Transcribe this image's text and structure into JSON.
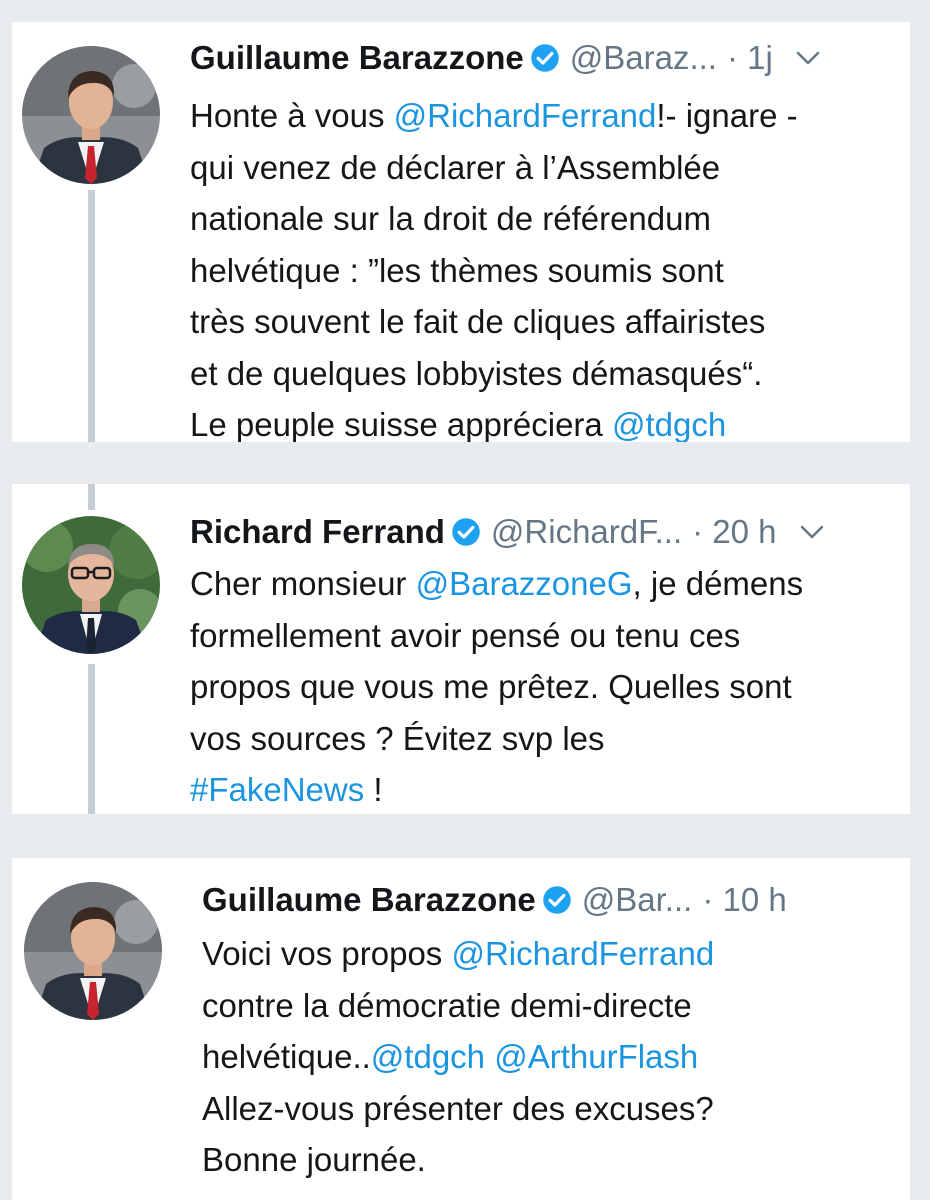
{
  "tweets": [
    {
      "author_name": "Guillaume Barazzone",
      "handle": "@Baraz...",
      "time": "· 1j",
      "avatar": "man-in-suit-red-tie",
      "lines": [
        [
          {
            "t": "Honte à vous ",
            "link": false
          },
          {
            "t": "@RichardFerrand",
            "link": true
          },
          {
            "t": "!- ignare -",
            "link": false
          }
        ],
        [
          {
            "t": "qui venez de déclarer à l’Assemblée",
            "link": false
          }
        ],
        [
          {
            "t": "nationale sur la droit de référendum",
            "link": false
          }
        ],
        [
          {
            "t": "helvétique : ”les thèmes soumis sont",
            "link": false
          }
        ],
        [
          {
            "t": "très souvent le fait de cliques affairistes",
            "link": false
          }
        ],
        [
          {
            "t": "et de quelques lobbyistes démasqués“.",
            "link": false
          }
        ],
        [
          {
            "t": "Le peuple suisse appréciera ",
            "link": false
          },
          {
            "t": "@tdgch",
            "link": true
          }
        ]
      ]
    },
    {
      "author_name": "Richard Ferrand",
      "handle": "@RichardF...",
      "time": "· 20 h",
      "avatar": "man-with-glasses",
      "lines": [
        [
          {
            "t": "Cher monsieur ",
            "link": false
          },
          {
            "t": "@BarazzoneG",
            "link": true
          },
          {
            "t": ", je démens",
            "link": false
          }
        ],
        [
          {
            "t": "formellement avoir pensé ou tenu ces",
            "link": false
          }
        ],
        [
          {
            "t": "propos que vous me prêtez. Quelles sont",
            "link": false
          }
        ],
        [
          {
            "t": "vos sources ? Évitez svp les",
            "link": false
          }
        ],
        [
          {
            "t": "#FakeNews",
            "link": true
          },
          {
            "t": " !",
            "link": false
          }
        ]
      ]
    },
    {
      "author_name": "Guillaume Barazzone",
      "handle": "@Bar...",
      "time": "· 10 h",
      "avatar": "man-in-suit-red-tie",
      "lines": [
        [
          {
            "t": "Voici vos propos ",
            "link": false
          },
          {
            "t": "@RichardFerrand",
            "link": true
          }
        ],
        [
          {
            "t": "contre la démocratie demi-directe",
            "link": false
          }
        ],
        [
          {
            "t": "helvétique..",
            "link": false
          },
          {
            "t": "@tdgch",
            "link": true
          },
          {
            "t": " ",
            "link": false
          },
          {
            "t": "@ArthurFlash",
            "link": true
          }
        ],
        [
          {
            "t": "Allez-vous présenter des excuses?",
            "link": false
          }
        ],
        [
          {
            "t": "Bonne journée.",
            "link": false
          }
        ]
      ]
    }
  ],
  "colors": {
    "link": "#1b95e0",
    "muted": "#657786",
    "text": "#14171a",
    "verified": "#1da1f2",
    "thread_line": "#c5ced6",
    "background": "#e8ecef"
  }
}
